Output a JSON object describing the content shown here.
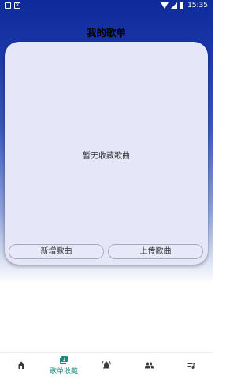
{
  "status_bar": {
    "time": "15:35",
    "left_icons": [
      "gallery-icon",
      "notification-icon"
    ],
    "right_icons": [
      "wifi-icon",
      "signal-icon",
      "battery-icon"
    ]
  },
  "header": {
    "title": "我的歌单"
  },
  "main": {
    "empty_message": "暂无收藏歌曲",
    "add_button_label": "新增歌曲",
    "upload_button_label": "上传歌曲"
  },
  "bottom_nav": {
    "active_color": "#1a8a7e",
    "inactive_color": "#3b3b3b",
    "items": [
      {
        "icon": "home-icon",
        "label": ""
      },
      {
        "icon": "playlist-collect-icon",
        "label": "歌单收藏"
      },
      {
        "icon": "alarm-bell-icon",
        "label": ""
      },
      {
        "icon": "people-icon",
        "label": ""
      },
      {
        "icon": "queue-music-icon",
        "label": ""
      }
    ]
  }
}
